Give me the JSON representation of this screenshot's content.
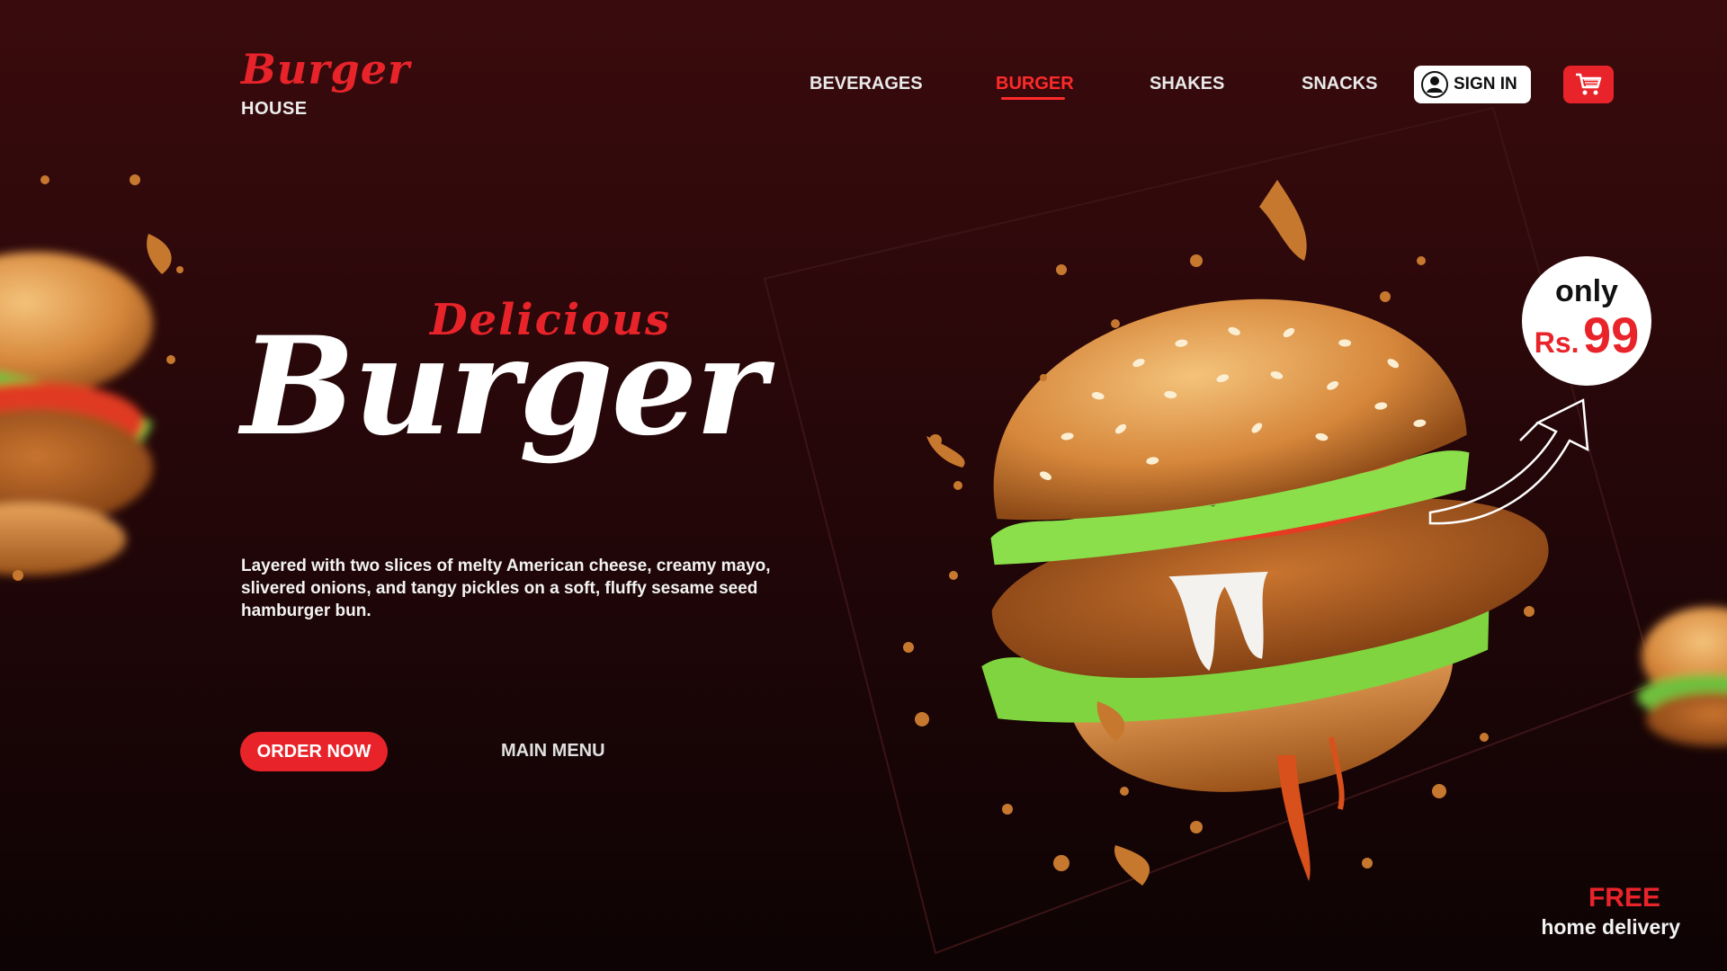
{
  "brand": {
    "script": "Burger",
    "sub": "HOUSE"
  },
  "nav": {
    "items": [
      {
        "label": "BEVERAGES"
      },
      {
        "label": "BURGER"
      },
      {
        "label": "SHAKES"
      },
      {
        "label": "SNACKS"
      }
    ],
    "active": "BURGER",
    "signin_label": "SIGN IN"
  },
  "hero": {
    "tagline": "Delicious",
    "title": "Burger",
    "description": "Layered with two slices of melty American cheese, creamy mayo, slivered onions, and tangy pickles on a soft, fluffy sesame seed hamburger bun.",
    "order_label": "ORDER NOW",
    "menu_label": "MAIN MENU"
  },
  "price_badge": {
    "only": "only",
    "currency": "Rs.",
    "value": "99"
  },
  "delivery": {
    "free": "FREE",
    "label": "home delivery"
  },
  "colors": {
    "accent": "#e8242a",
    "bg_top": "#3a0b0d",
    "bg_bottom": "#0d0304"
  },
  "icons": [
    "user-icon",
    "cart-icon",
    "arrow-icon"
  ]
}
